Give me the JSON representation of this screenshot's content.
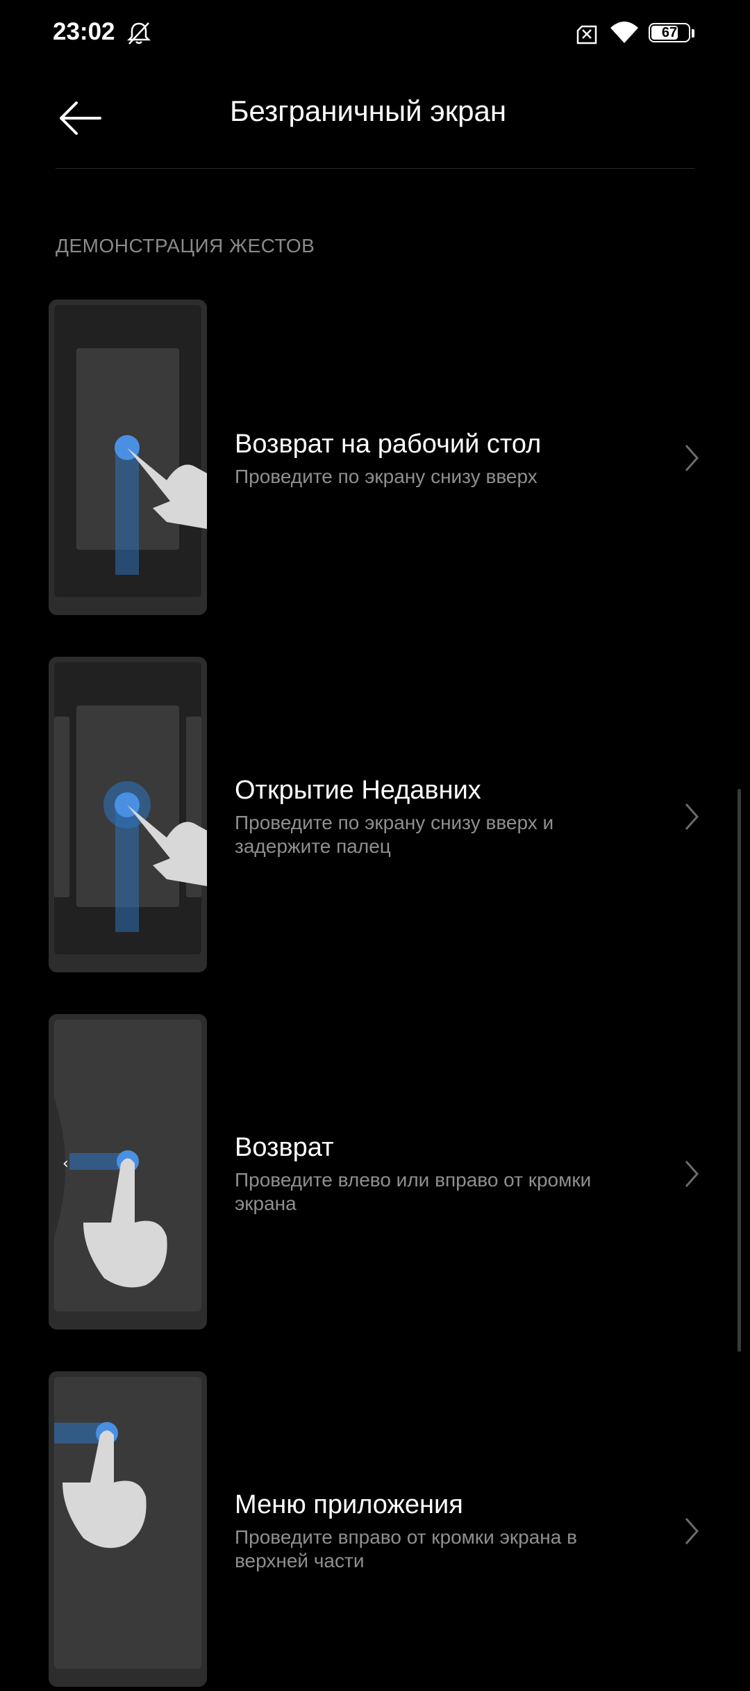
{
  "status": {
    "time": "23:02",
    "battery": "67"
  },
  "header": {
    "title": "Безграничный экран"
  },
  "section": {
    "label": "ДЕМОНСТРАЦИЯ ЖЕСТОВ"
  },
  "items": [
    {
      "title": "Возврат на рабочий стол",
      "subtitle": "Проведите по экрану снизу вверх"
    },
    {
      "title": "Открытие Недавних",
      "subtitle": "Проведите по экрану снизу вверх и задержите палец"
    },
    {
      "title": "Возврат",
      "subtitle": "Проведите влево или вправо от кромки экрана"
    },
    {
      "title": "Меню приложения",
      "subtitle": "Проведите вправо от кромки экрана в верхней части"
    }
  ]
}
